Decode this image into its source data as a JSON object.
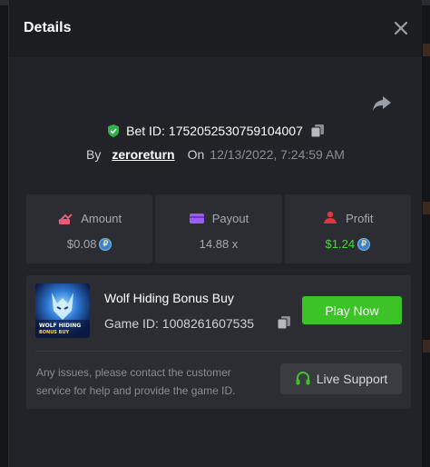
{
  "modal": {
    "title": "Details",
    "close_icon": "close-icon",
    "share_icon": "share-icon"
  },
  "bet": {
    "label": "Bet ID:",
    "id": "1752052530759104007",
    "by_label": "By",
    "username": "zeroreturn",
    "on_label": "On",
    "datetime": "12/13/2022, 7:24:59 AM"
  },
  "stats": [
    {
      "label": "Amount",
      "value": "$0.08",
      "icon": "amount-icon",
      "icon_color": "#e85a7a",
      "has_coin": true
    },
    {
      "label": "Payout",
      "value": "14.88 x",
      "icon": "wallet-icon",
      "icon_color": "#9a5cf5",
      "has_coin": false
    },
    {
      "label": "Profit",
      "value": "$1.24",
      "icon": "profit-icon",
      "icon_color": "#e0383a",
      "has_coin": true
    }
  ],
  "game": {
    "name": "Wolf Hiding Bonus Buy",
    "id_label": "Game ID:",
    "id": "1008261607535",
    "play_label": "Play Now",
    "thumb_text_line1": "WOLF HIDING",
    "thumb_text_line2": "BONUS BUY"
  },
  "support": {
    "help_text": "Any issues, please contact the customer service for help and provide the game ID.",
    "button_label": "Live Support"
  },
  "colors": {
    "accent_green": "#3cc328",
    "profit_green": "#49d63b",
    "shield_green": "#2fb24a"
  }
}
